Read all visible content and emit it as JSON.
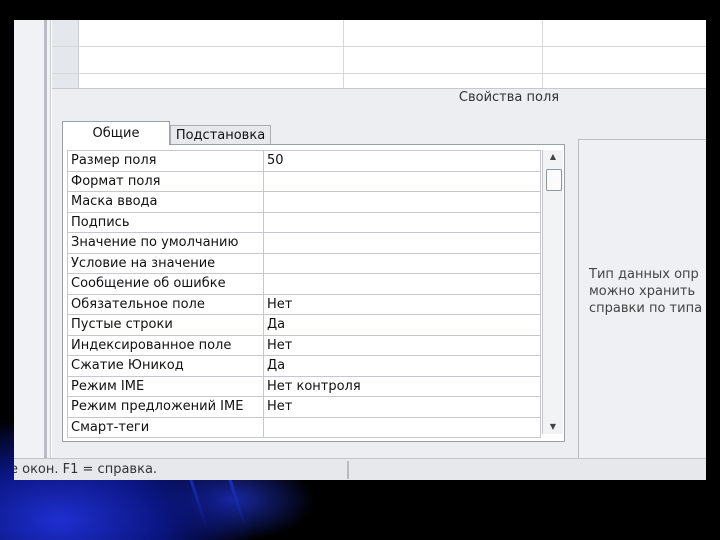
{
  "properties_panel": {
    "title": "Свойства поля",
    "tabs": [
      {
        "label": "Общие",
        "active": true
      },
      {
        "label": "Подстановка",
        "active": false
      }
    ],
    "rows": [
      {
        "name": "Размер поля",
        "value": "50"
      },
      {
        "name": "Формат поля",
        "value": ""
      },
      {
        "name": "Маска ввода",
        "value": ""
      },
      {
        "name": "Подпись",
        "value": ""
      },
      {
        "name": "Значение по умолчанию",
        "value": ""
      },
      {
        "name": "Условие на значение",
        "value": ""
      },
      {
        "name": "Сообщение об ошибке",
        "value": ""
      },
      {
        "name": "Обязательное поле",
        "value": "Нет"
      },
      {
        "name": "Пустые строки",
        "value": "Да"
      },
      {
        "name": "Индексированное поле",
        "value": "Нет"
      },
      {
        "name": "Сжатие Юникод",
        "value": "Да"
      },
      {
        "name": "Режим IME",
        "value": "Нет контроля"
      },
      {
        "name": "Режим предложений IME",
        "value": "Нет"
      },
      {
        "name": "Смарт-теги",
        "value": ""
      }
    ],
    "help_lines": [
      "Тип данных опр",
      "можно хранить",
      "справки по типа"
    ]
  },
  "status_bar": {
    "text": "е окон.  F1 = справка."
  },
  "icons": {
    "scroll_up": "scroll-up-arrow-icon",
    "scroll_down": "scroll-down-arrow-icon"
  },
  "colors": {
    "background": "#000000",
    "glow": "#1f2fd0",
    "panel": "#eceef1"
  }
}
